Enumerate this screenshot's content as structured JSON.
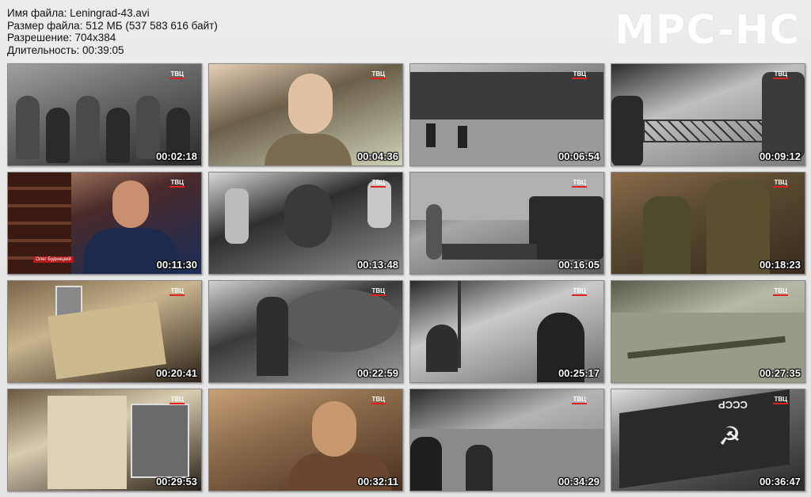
{
  "info": {
    "filename": "Имя файла: Leningrad-43.avi",
    "filesize": "Размер файла: 512 МБ (537 583 616 байт)",
    "resolution": "Разрешение: 704x384",
    "duration": "Длительность: 00:39:05"
  },
  "brand": "MPC-HC",
  "channel_logo": "ТВЦ",
  "thumbnails": [
    {
      "time": "00:02:18",
      "scene": "soldiers-crowd",
      "colors": [
        "#2a2a2a",
        "#6a6a6a",
        "#a0a0a0"
      ]
    },
    {
      "time": "00:04:36",
      "scene": "interview-man",
      "colors": [
        "#cfd2b8",
        "#6b5f4a",
        "#e8d0b8"
      ]
    },
    {
      "time": "00:06:54",
      "scene": "river-crossing",
      "colors": [
        "#3a3a3a",
        "#8c8c8c",
        "#c8c8c8"
      ]
    },
    {
      "time": "00:09:12",
      "scene": "bridge",
      "colors": [
        "#7a7a7a",
        "#bfbfbf",
        "#2c2c2c"
      ]
    },
    {
      "time": "00:11:30",
      "scene": "studio-guest",
      "colors": [
        "#1a2e5a",
        "#4a2a2a",
        "#c09070"
      ]
    },
    {
      "time": "00:13:48",
      "scene": "surrender",
      "colors": [
        "#8e8e8e",
        "#2e2e2e",
        "#d8d8d8"
      ]
    },
    {
      "time": "00:16:05",
      "scene": "tank-train",
      "colors": [
        "#5a5a5a",
        "#a8a8a8",
        "#1e1e1e"
      ]
    },
    {
      "time": "00:18:23",
      "scene": "officers-table",
      "colors": [
        "#3a2a1e",
        "#5a4a30",
        "#8a6a4a"
      ]
    },
    {
      "time": "00:20:41",
      "scene": "documents-photo",
      "colors": [
        "#2e2218",
        "#c8b48e",
        "#7a6448"
      ]
    },
    {
      "time": "00:22:59",
      "scene": "soldier-smoke",
      "colors": [
        "#9a9a9a",
        "#3a3a3a",
        "#d0d0d0"
      ]
    },
    {
      "time": "00:25:17",
      "scene": "helmets-march",
      "colors": [
        "#6a6a6a",
        "#cacaca",
        "#2a2a2a"
      ]
    },
    {
      "time": "00:27:35",
      "scene": "landscape-troops",
      "colors": [
        "#8a8a7a",
        "#b8b8a8",
        "#5a5a4a"
      ]
    },
    {
      "time": "00:29:53",
      "scene": "book-pages",
      "colors": [
        "#2a2018",
        "#d8ccb0",
        "#6a5840"
      ]
    },
    {
      "time": "00:32:11",
      "scene": "man-dark-room",
      "colors": [
        "#4a3020",
        "#8a6a4a",
        "#c8a078"
      ]
    },
    {
      "time": "00:34:29",
      "scene": "battle-field",
      "colors": [
        "#7a7a7a",
        "#b4b4b4",
        "#2a2a2a"
      ]
    },
    {
      "time": "00:36:47",
      "scene": "ussr-flag",
      "colors": [
        "#2a2a2a",
        "#6a6a6a",
        "#e0e0e0"
      ]
    }
  ],
  "flag_text": "СССР",
  "caption_text": "Олег Будницкий"
}
